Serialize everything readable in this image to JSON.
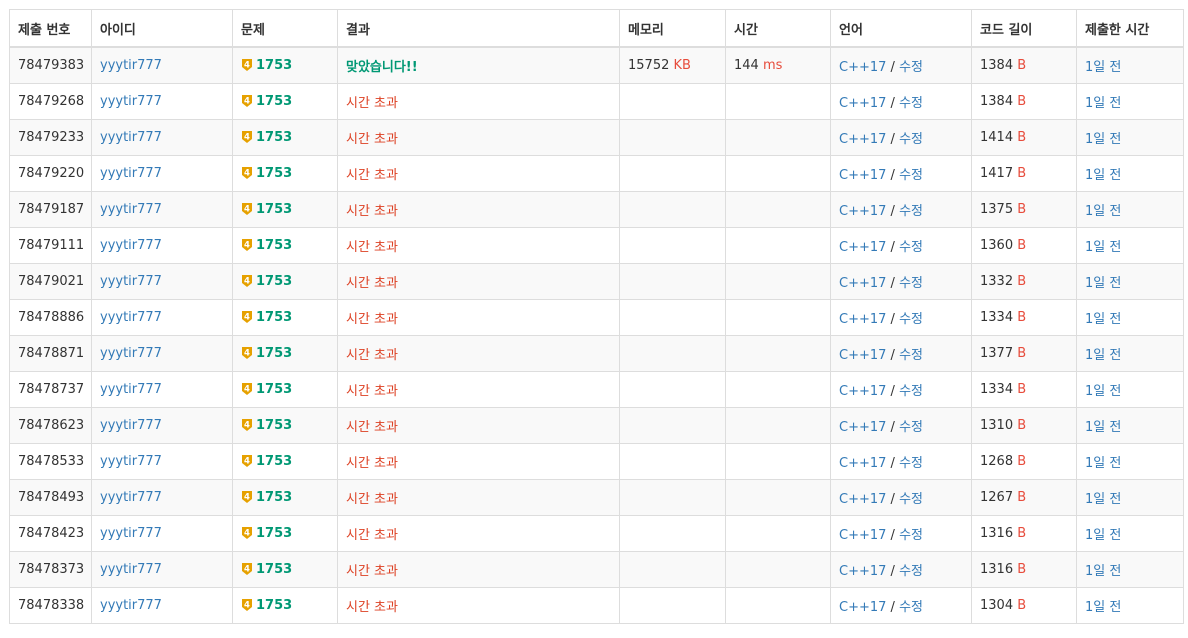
{
  "colors": {
    "link": "#337ab7",
    "accepted": "#009874",
    "time_limit": "#dd4124",
    "unit": "#e74c3c",
    "tier_badge": "#e6a100"
  },
  "headers": [
    "제출 번호",
    "아이디",
    "문제",
    "결과",
    "메모리",
    "시간",
    "언어",
    "코드 길이",
    "제출한 시간"
  ],
  "rows": [
    {
      "id": "78479383",
      "user": "yyytir777",
      "tier": "4",
      "problem": "1753",
      "result": "맞았습니다!!",
      "result_type": "accepted",
      "memory": "15752",
      "memory_unit": "KB",
      "time": "144",
      "time_unit": "ms",
      "lang": "C++17",
      "lang_sep": " / ",
      "edit": "수정",
      "code_len": "1384",
      "code_unit": "B",
      "submitted": "1일 전"
    },
    {
      "id": "78479268",
      "user": "yyytir777",
      "tier": "4",
      "problem": "1753",
      "result": "시간 초과",
      "result_type": "tle",
      "memory": "",
      "memory_unit": "",
      "time": "",
      "time_unit": "",
      "lang": "C++17",
      "lang_sep": " / ",
      "edit": "수정",
      "code_len": "1384",
      "code_unit": "B",
      "submitted": "1일 전"
    },
    {
      "id": "78479233",
      "user": "yyytir777",
      "tier": "4",
      "problem": "1753",
      "result": "시간 초과",
      "result_type": "tle",
      "memory": "",
      "memory_unit": "",
      "time": "",
      "time_unit": "",
      "lang": "C++17",
      "lang_sep": " / ",
      "edit": "수정",
      "code_len": "1414",
      "code_unit": "B",
      "submitted": "1일 전"
    },
    {
      "id": "78479220",
      "user": "yyytir777",
      "tier": "4",
      "problem": "1753",
      "result": "시간 초과",
      "result_type": "tle",
      "memory": "",
      "memory_unit": "",
      "time": "",
      "time_unit": "",
      "lang": "C++17",
      "lang_sep": " / ",
      "edit": "수정",
      "code_len": "1417",
      "code_unit": "B",
      "submitted": "1일 전"
    },
    {
      "id": "78479187",
      "user": "yyytir777",
      "tier": "4",
      "problem": "1753",
      "result": "시간 초과",
      "result_type": "tle",
      "memory": "",
      "memory_unit": "",
      "time": "",
      "time_unit": "",
      "lang": "C++17",
      "lang_sep": " / ",
      "edit": "수정",
      "code_len": "1375",
      "code_unit": "B",
      "submitted": "1일 전"
    },
    {
      "id": "78479111",
      "user": "yyytir777",
      "tier": "4",
      "problem": "1753",
      "result": "시간 초과",
      "result_type": "tle",
      "memory": "",
      "memory_unit": "",
      "time": "",
      "time_unit": "",
      "lang": "C++17",
      "lang_sep": " / ",
      "edit": "수정",
      "code_len": "1360",
      "code_unit": "B",
      "submitted": "1일 전"
    },
    {
      "id": "78479021",
      "user": "yyytir777",
      "tier": "4",
      "problem": "1753",
      "result": "시간 초과",
      "result_type": "tle",
      "memory": "",
      "memory_unit": "",
      "time": "",
      "time_unit": "",
      "lang": "C++17",
      "lang_sep": " / ",
      "edit": "수정",
      "code_len": "1332",
      "code_unit": "B",
      "submitted": "1일 전"
    },
    {
      "id": "78478886",
      "user": "yyytir777",
      "tier": "4",
      "problem": "1753",
      "result": "시간 초과",
      "result_type": "tle",
      "memory": "",
      "memory_unit": "",
      "time": "",
      "time_unit": "",
      "lang": "C++17",
      "lang_sep": " / ",
      "edit": "수정",
      "code_len": "1334",
      "code_unit": "B",
      "submitted": "1일 전"
    },
    {
      "id": "78478871",
      "user": "yyytir777",
      "tier": "4",
      "problem": "1753",
      "result": "시간 초과",
      "result_type": "tle",
      "memory": "",
      "memory_unit": "",
      "time": "",
      "time_unit": "",
      "lang": "C++17",
      "lang_sep": " / ",
      "edit": "수정",
      "code_len": "1377",
      "code_unit": "B",
      "submitted": "1일 전"
    },
    {
      "id": "78478737",
      "user": "yyytir777",
      "tier": "4",
      "problem": "1753",
      "result": "시간 초과",
      "result_type": "tle",
      "memory": "",
      "memory_unit": "",
      "time": "",
      "time_unit": "",
      "lang": "C++17",
      "lang_sep": " / ",
      "edit": "수정",
      "code_len": "1334",
      "code_unit": "B",
      "submitted": "1일 전"
    },
    {
      "id": "78478623",
      "user": "yyytir777",
      "tier": "4",
      "problem": "1753",
      "result": "시간 초과",
      "result_type": "tle",
      "memory": "",
      "memory_unit": "",
      "time": "",
      "time_unit": "",
      "lang": "C++17",
      "lang_sep": " / ",
      "edit": "수정",
      "code_len": "1310",
      "code_unit": "B",
      "submitted": "1일 전"
    },
    {
      "id": "78478533",
      "user": "yyytir777",
      "tier": "4",
      "problem": "1753",
      "result": "시간 초과",
      "result_type": "tle",
      "memory": "",
      "memory_unit": "",
      "time": "",
      "time_unit": "",
      "lang": "C++17",
      "lang_sep": " / ",
      "edit": "수정",
      "code_len": "1268",
      "code_unit": "B",
      "submitted": "1일 전"
    },
    {
      "id": "78478493",
      "user": "yyytir777",
      "tier": "4",
      "problem": "1753",
      "result": "시간 초과",
      "result_type": "tle",
      "memory": "",
      "memory_unit": "",
      "time": "",
      "time_unit": "",
      "lang": "C++17",
      "lang_sep": " / ",
      "edit": "수정",
      "code_len": "1267",
      "code_unit": "B",
      "submitted": "1일 전"
    },
    {
      "id": "78478423",
      "user": "yyytir777",
      "tier": "4",
      "problem": "1753",
      "result": "시간 초과",
      "result_type": "tle",
      "memory": "",
      "memory_unit": "",
      "time": "",
      "time_unit": "",
      "lang": "C++17",
      "lang_sep": " / ",
      "edit": "수정",
      "code_len": "1316",
      "code_unit": "B",
      "submitted": "1일 전"
    },
    {
      "id": "78478373",
      "user": "yyytir777",
      "tier": "4",
      "problem": "1753",
      "result": "시간 초과",
      "result_type": "tle",
      "memory": "",
      "memory_unit": "",
      "time": "",
      "time_unit": "",
      "lang": "C++17",
      "lang_sep": " / ",
      "edit": "수정",
      "code_len": "1316",
      "code_unit": "B",
      "submitted": "1일 전"
    },
    {
      "id": "78478338",
      "user": "yyytir777",
      "tier": "4",
      "problem": "1753",
      "result": "시간 초과",
      "result_type": "tle",
      "memory": "",
      "memory_unit": "",
      "time": "",
      "time_unit": "",
      "lang": "C++17",
      "lang_sep": " / ",
      "edit": "수정",
      "code_len": "1304",
      "code_unit": "B",
      "submitted": "1일 전"
    }
  ]
}
